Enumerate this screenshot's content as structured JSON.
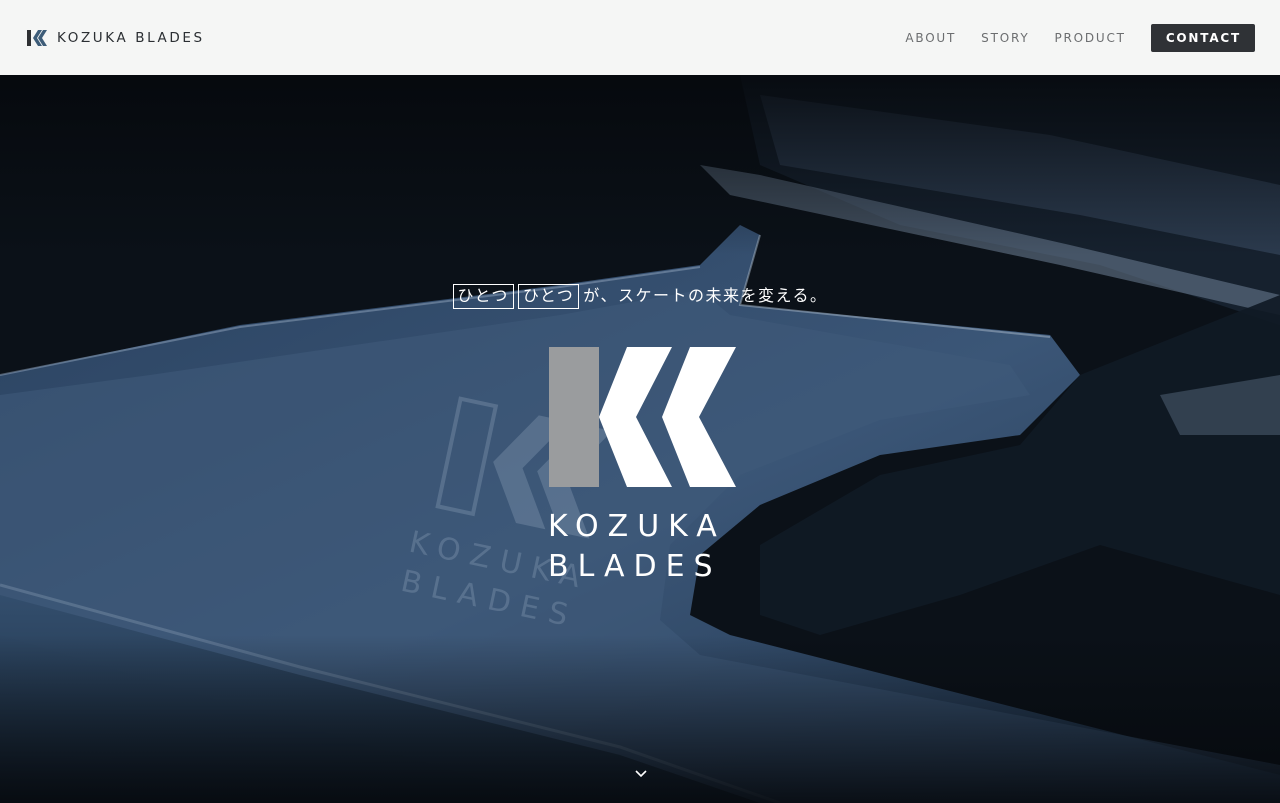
{
  "header": {
    "brand_name": "KOZUKA BLADES",
    "logo_icon": "kozuka-mark-icon",
    "nav": [
      {
        "label": "ABOUT"
      },
      {
        "label": "STORY"
      },
      {
        "label": "PRODUCT"
      }
    ],
    "contact_label": "CONTACT"
  },
  "hero": {
    "tagline_boxed_1": "ひとつ",
    "tagline_boxed_2": "ひとつ",
    "tagline_rest": "が、スケートの未来を変える。",
    "logo_icon": "kozuka-blades-logo",
    "wordmark_line1": "KOZUKA",
    "wordmark_line2": "BLADES",
    "scroll_icon": "chevron-down-icon"
  },
  "colors": {
    "header_bg": "#f5f6f5",
    "contact_bg": "#2f3236",
    "brand_blue": "#3d5c78",
    "hero_tint": "#2b4562"
  }
}
